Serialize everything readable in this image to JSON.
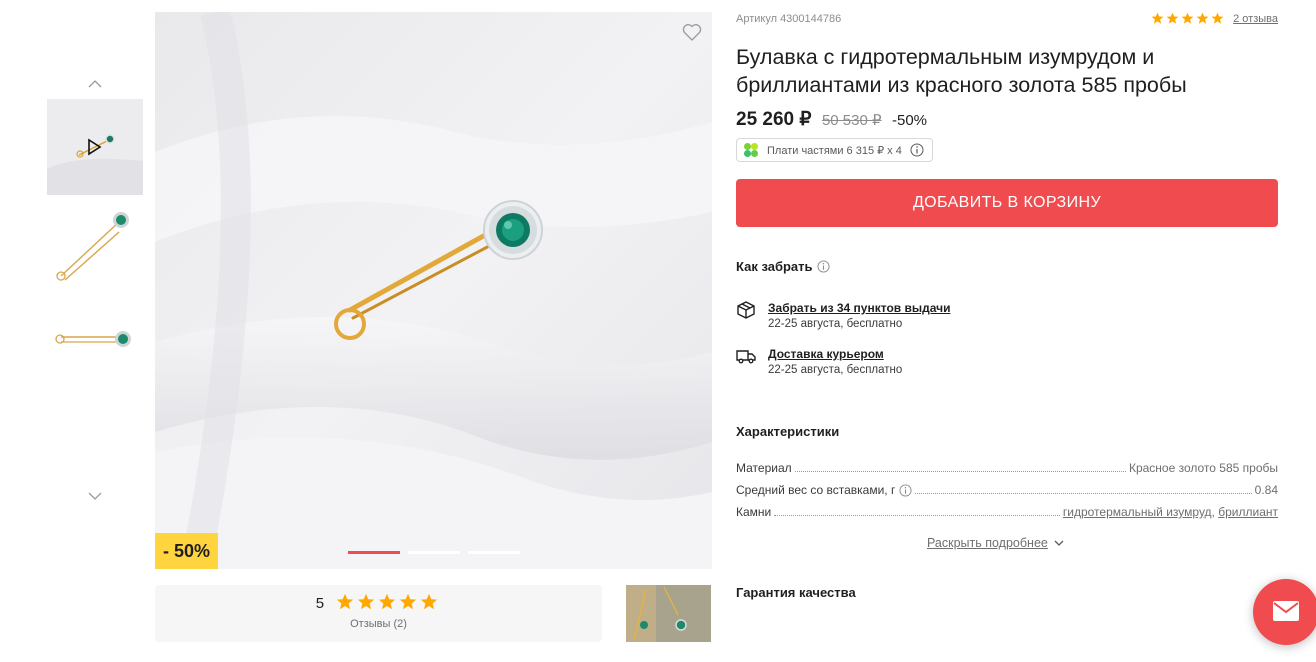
{
  "product": {
    "sku": "Артикул 4300144786",
    "title": "Булавка с гидротермальным изумрудом и бриллиантами из красного золота 585 пробы",
    "reviews_link": "2 отзыва",
    "price": "25 260 ₽",
    "old_price": "50 530 ₽",
    "discount_percent": "-50%",
    "split_text": "Плати частями 6 315 ₽ x 4",
    "add_to_cart": "ДОБАВИТЬ В КОРЗИНУ"
  },
  "gallery": {
    "badge": "- 50%",
    "active_slide": 1,
    "slides": 3,
    "thumbnails": 3
  },
  "rating": {
    "score": "5",
    "stars": 5,
    "reviews_label": "Отзывы (2)"
  },
  "delivery": {
    "title": "Как забрать",
    "options": [
      {
        "label": "Забрать из 34 пунктов выдачи",
        "sub": "22-25 августа, бесплатно",
        "icon": "box-icon"
      },
      {
        "label": "Доставка курьером",
        "sub": "22-25 августа, бесплатно",
        "icon": "truck-icon"
      }
    ]
  },
  "specs": {
    "title": "Характеристики",
    "rows": [
      {
        "label": "Материал",
        "value": "Красное золото 585 пробы"
      },
      {
        "label": "Средний вес со вставками, г",
        "value": "0.84"
      },
      {
        "label": "Камни",
        "value_1": "гидротермальный изумруд",
        "separator": ",",
        "value_2": "бриллиант"
      }
    ],
    "expand": "Раскрыть подробнее"
  },
  "guarantee": "Гарантия качества",
  "colors": {
    "accent": "#f04c4f",
    "star": "#ffa800",
    "badge": "#ffd53f"
  }
}
